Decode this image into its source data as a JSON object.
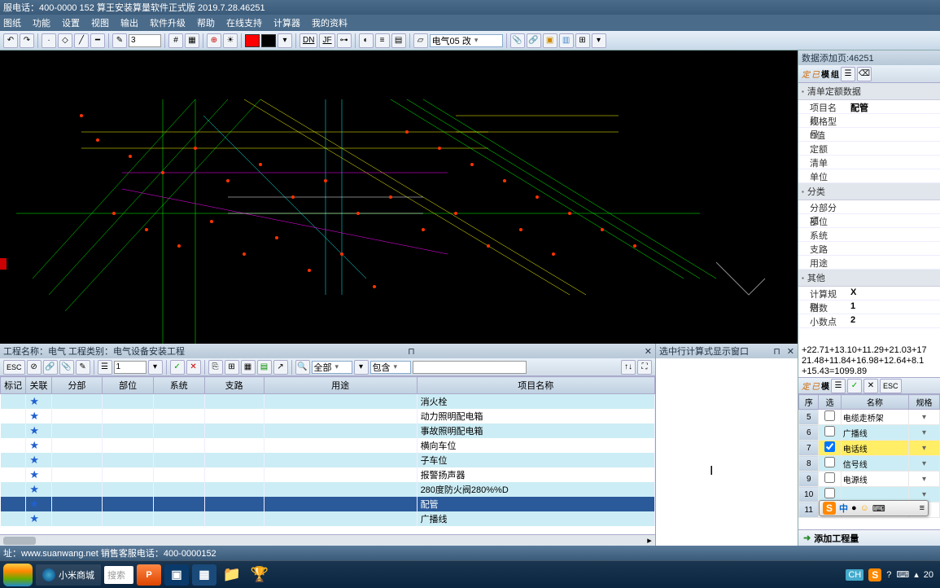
{
  "title_bar": "服电话：400-0000 152   算王安装算量软件正式版 2019.7.28.46251",
  "menu": [
    "图纸",
    "功能",
    "设置",
    "视图",
    "输出",
    "软件升级",
    "帮助",
    "在线支持",
    "计算器",
    "我的资料"
  ],
  "toolbar_top": {
    "line_weight": "3",
    "layer": "电气05 改"
  },
  "right_panel": {
    "header": "数据添加页:46251",
    "sections": [
      {
        "title": "清单定额数据",
        "rows": [
          {
            "label": "项目名称",
            "value": "配管"
          },
          {
            "label": "规格型号",
            "value": ""
          },
          {
            "label": "D值",
            "value": ""
          },
          {
            "label": "定额",
            "value": ""
          },
          {
            "label": "清单",
            "value": ""
          },
          {
            "label": "单位",
            "value": ""
          }
        ]
      },
      {
        "title": "分类",
        "rows": [
          {
            "label": "分部分项",
            "value": ""
          },
          {
            "label": "部位",
            "value": ""
          },
          {
            "label": "系统",
            "value": ""
          },
          {
            "label": "支路",
            "value": ""
          },
          {
            "label": "用途",
            "value": ""
          }
        ]
      },
      {
        "title": "其他",
        "rows": [
          {
            "label": "计算规则",
            "value": "X"
          },
          {
            "label": "倍数",
            "value": "1"
          },
          {
            "label": "小数点",
            "value": "2"
          }
        ]
      }
    ]
  },
  "left_mid": {
    "header": "工程名称：电气  工程类别：电气设备安装工程",
    "tool_num": "1",
    "tool_all": "全部",
    "tool_contain": "包含",
    "columns": [
      "标记",
      "关联",
      "分部",
      "部位",
      "系统",
      "支路",
      "用途",
      "项目名称"
    ],
    "rows": [
      {
        "name": "消火栓"
      },
      {
        "name": "动力照明配电箱"
      },
      {
        "name": "事故照明配电箱"
      },
      {
        "name": "横向车位"
      },
      {
        "name": "子车位"
      },
      {
        "name": "报警扬声器"
      },
      {
        "name": "280度防火阀280%%D"
      },
      {
        "name": "配管",
        "highlight": true
      },
      {
        "name": "广播线"
      }
    ]
  },
  "right_mid": {
    "header": "选中行计算式显示窗口"
  },
  "formula": "+22.71+13.10+11.29+21.03+17\n21.48+11.84+16.98+12.64+8.1\n+15.43=1099.89",
  "mini_table": {
    "columns": [
      "序",
      "选",
      "名称",
      "规格"
    ],
    "rows": [
      {
        "idx": "5",
        "chk": false,
        "name": "电缆走桥架"
      },
      {
        "idx": "6",
        "chk": false,
        "name": "广播线"
      },
      {
        "idx": "7",
        "chk": true,
        "name": "电话线",
        "selected": true
      },
      {
        "idx": "8",
        "chk": false,
        "name": "信号线"
      },
      {
        "idx": "9",
        "chk": false,
        "name": "电源线"
      },
      {
        "idx": "10",
        "chk": false,
        "name": ""
      },
      {
        "idx": "11",
        "chk": false,
        "name": ""
      }
    ],
    "add_label": "添加工程量"
  },
  "status_bar": "址：www.suanwang.net 销售客服电话：400-0000152",
  "taskbar": {
    "ie_label": "小米商城",
    "search_label": "搜索",
    "systray": {
      "time": "20"
    }
  },
  "ime": {
    "s": "S",
    "zh": "中"
  },
  "panel_btns": [
    "定",
    "已",
    "模",
    "组"
  ]
}
